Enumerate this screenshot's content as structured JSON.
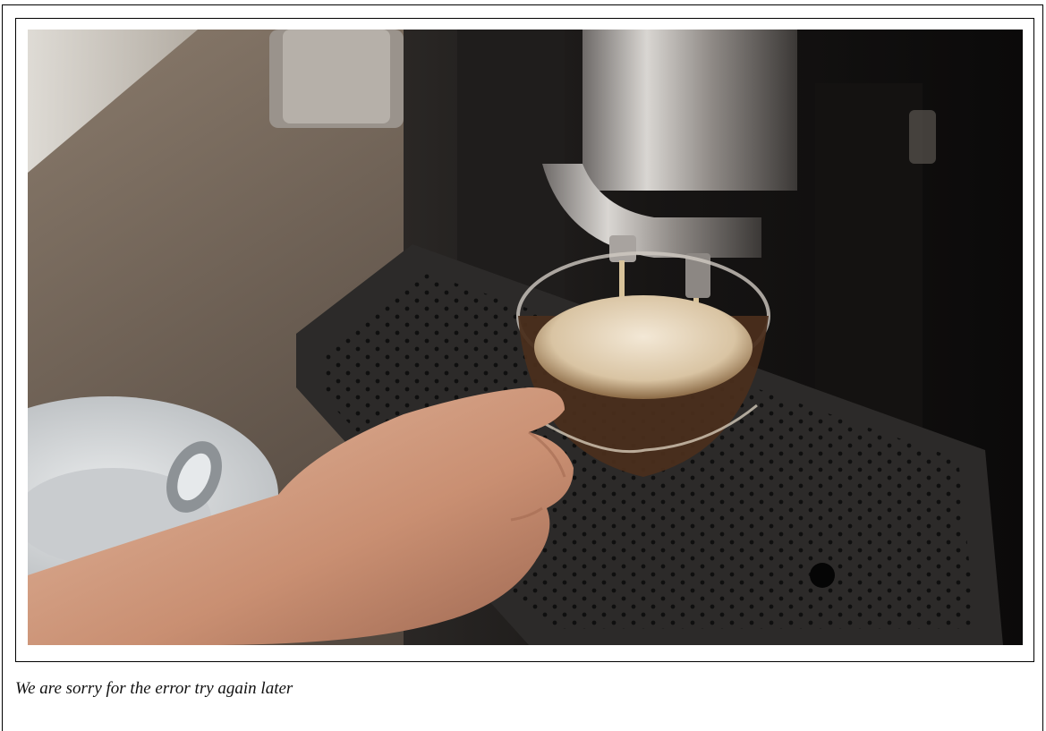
{
  "photo": {
    "subject": "coffee-machine-pouring-into-glass-cup"
  },
  "error": {
    "message": "We are sorry for the error try again later"
  },
  "colors": {
    "frame_border": "#000000",
    "background": "#ffffff",
    "message_text": "#111111"
  }
}
